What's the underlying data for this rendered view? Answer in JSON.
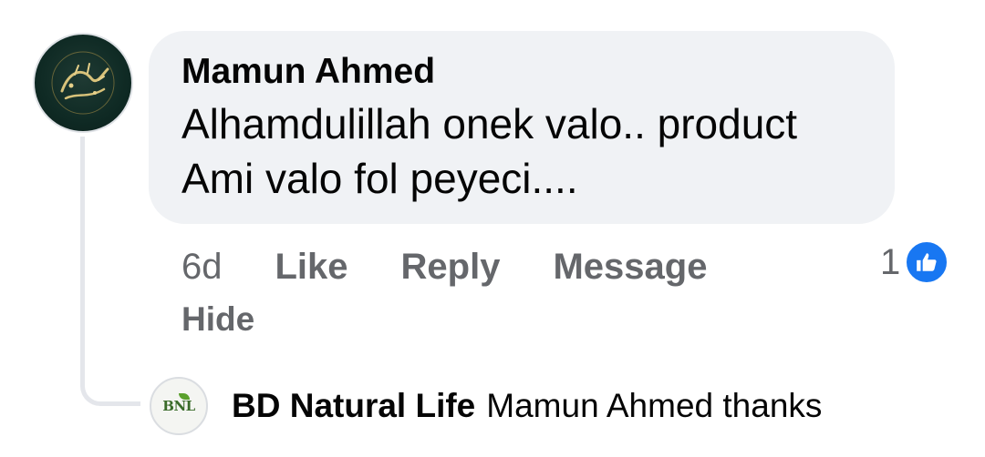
{
  "comment": {
    "author": "Mamun Ahmed",
    "text_line1": "Alhamdulillah onek valo.. product",
    "text_line2": "Ami valo fol peyeci....",
    "time": "6d",
    "actions": {
      "like": "Like",
      "reply": "Reply",
      "message": "Message",
      "hide": "Hide"
    },
    "reaction_count": "1",
    "reaction_icon": "like-thumb-icon"
  },
  "reply": {
    "avatar_text": "BNL",
    "author": "BD Natural Life",
    "text": "Mamun Ahmed thanks"
  },
  "colors": {
    "bubble_bg": "#f0f2f5",
    "secondary_text": "#65676b",
    "primary_text": "#050505",
    "like_blue": "#1877f2"
  }
}
